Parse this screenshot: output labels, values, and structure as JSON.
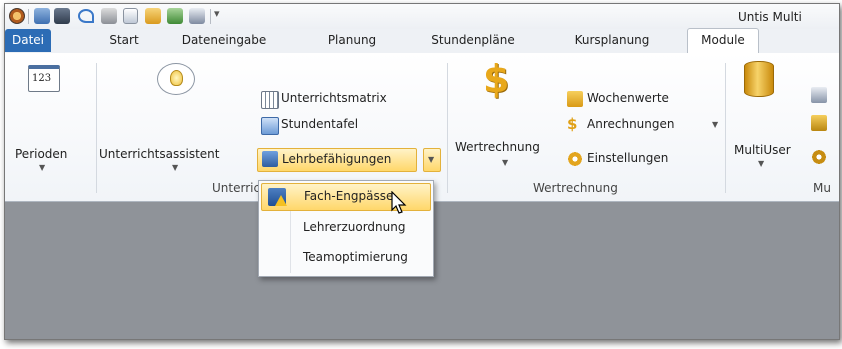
{
  "window": {
    "title": "Untis Multi"
  },
  "tabs": [
    {
      "label": "Datei"
    },
    {
      "label": "Start"
    },
    {
      "label": "Dateneingabe"
    },
    {
      "label": "Planung"
    },
    {
      "label": "Stundenpläne"
    },
    {
      "label": "Kursplanung"
    },
    {
      "label": "Module"
    }
  ],
  "ribbon": {
    "perioden": {
      "label": "Perioden",
      "badge": "123"
    },
    "unterrichtsassistent": {
      "label": "Unterrichtsassistent"
    },
    "small_unterricht": [
      {
        "label": "Unterrichtsmatrix"
      },
      {
        "label": "Stundentafel"
      },
      {
        "label": "Lehrbefähigungen"
      }
    ],
    "group_unterricht": "Unterric",
    "wertrechnung": {
      "label": "Wertrechnung"
    },
    "small_wert": [
      {
        "label": "Wochenwerte"
      },
      {
        "label": "Anrechnungen"
      },
      {
        "label": "Einstellungen"
      }
    ],
    "group_wert": "Wertrechnung",
    "multiuser": {
      "label": "MultiUser"
    },
    "group_mu": "Mu"
  },
  "menu": {
    "items": [
      {
        "label": "Fach-Engpässe"
      },
      {
        "label": "Lehrerzuordnung"
      },
      {
        "label": "Teamoptimierung"
      }
    ]
  },
  "colors": {
    "accent": "#2c6cb5",
    "highlight": "#ffd76a",
    "workspace": "#8f9399"
  }
}
